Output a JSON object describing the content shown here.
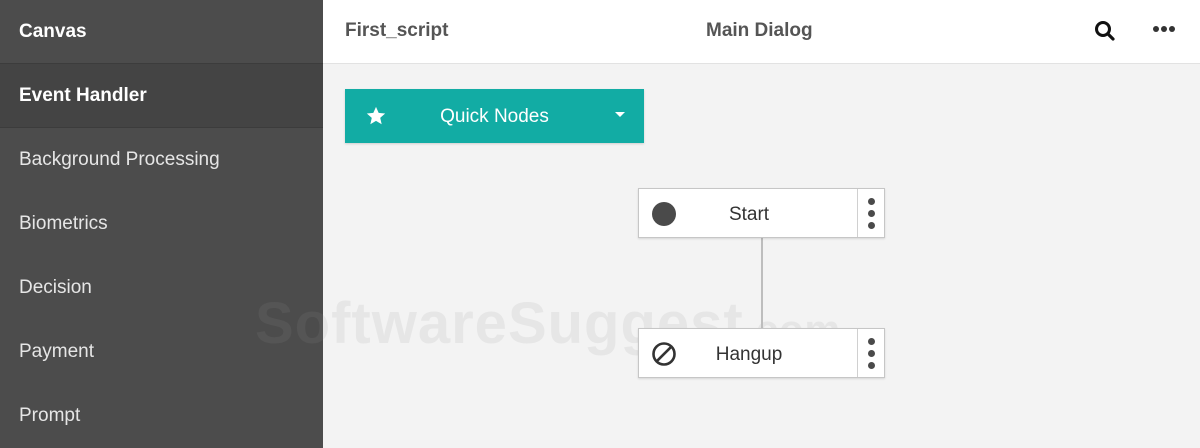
{
  "sidebar": {
    "header": "Canvas",
    "section": "Event Handler",
    "items": [
      {
        "label": "Background Processing"
      },
      {
        "label": "Biometrics"
      },
      {
        "label": "Decision"
      },
      {
        "label": "Payment"
      },
      {
        "label": "Prompt"
      }
    ]
  },
  "topbar": {
    "script_name": "First_script",
    "dialog_name": "Main Dialog",
    "search_icon": "search-icon",
    "more_icon": "more-horizontal-icon"
  },
  "quick_nodes": {
    "label": "Quick Nodes",
    "icon": "star-icon",
    "color": "#12aca4"
  },
  "nodes": [
    {
      "label": "Start",
      "icon": "filled-circle-icon"
    },
    {
      "label": "Hangup",
      "icon": "prohibited-icon"
    }
  ],
  "watermark": {
    "text": "SoftwareSuggest",
    "suffix": ".com"
  }
}
